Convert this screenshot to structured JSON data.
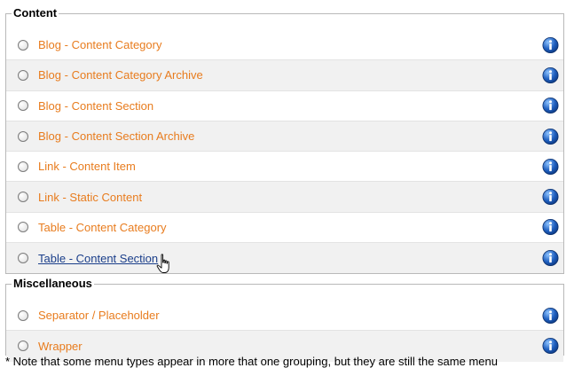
{
  "content_group": {
    "legend": "Content",
    "items": [
      {
        "label": "Blog - Content Category"
      },
      {
        "label": "Blog - Content Category Archive"
      },
      {
        "label": "Blog - Content Section"
      },
      {
        "label": "Blog - Content Section Archive"
      },
      {
        "label": "Link - Content Item"
      },
      {
        "label": "Link - Static Content"
      },
      {
        "label": "Table - Content Category"
      },
      {
        "label": "Table - Content Section"
      }
    ]
  },
  "misc_group": {
    "legend": "Miscellaneous",
    "items": [
      {
        "label": "Separator / Placeholder"
      },
      {
        "label": "Wrapper"
      }
    ]
  },
  "footnote": "* Note that some menu types appear in more that one grouping, but they are still the same menu",
  "hovered_item": "Table - Content Section",
  "colors": {
    "link": "#e87c1e",
    "link_hover": "#1a3e8a",
    "info_icon": "#1f5fbf"
  },
  "icons": {
    "info": "info-icon",
    "cursor": "hand-cursor-icon"
  }
}
